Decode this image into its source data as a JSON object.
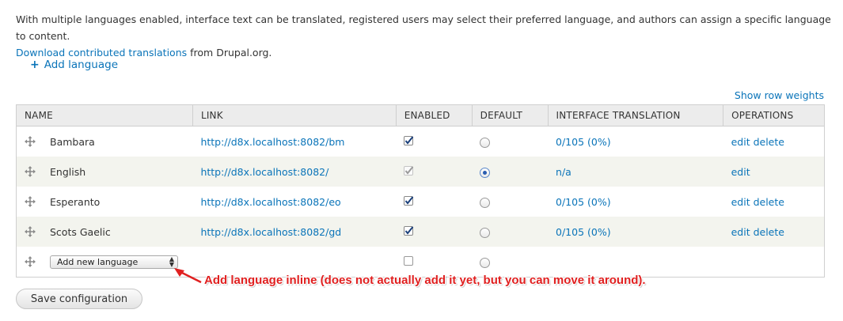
{
  "intro": {
    "text": "With multiple languages enabled, interface text can be translated, registered users may select their preferred language, and authors can assign a specific language to content.",
    "link_text": "Download contributed translations",
    "link_suffix": " from Drupal.org."
  },
  "actions": {
    "add_language": "Add language",
    "show_row_weights": "Show row weights"
  },
  "table": {
    "headers": [
      "NAME",
      "LINK",
      "ENABLED",
      "DEFAULT",
      "INTERFACE TRANSLATION",
      "OPERATIONS"
    ],
    "rows": [
      {
        "name": "Bambara",
        "link": "http://d8x.localhost:8082/bm",
        "enabled": true,
        "default": false,
        "translation": "0/105 (0%)",
        "ops": [
          "edit",
          "delete"
        ]
      },
      {
        "name": "English",
        "link": "http://d8x.localhost:8082/",
        "enabled": true,
        "default": true,
        "translation": "n/a",
        "ops": [
          "edit"
        ]
      },
      {
        "name": "Esperanto",
        "link": "http://d8x.localhost:8082/eo",
        "enabled": true,
        "default": false,
        "translation": "0/105 (0%)",
        "ops": [
          "edit",
          "delete"
        ]
      },
      {
        "name": "Scots Gaelic",
        "link": "http://d8x.localhost:8082/gd",
        "enabled": true,
        "default": false,
        "translation": "0/105 (0%)",
        "ops": [
          "edit",
          "delete"
        ]
      }
    ],
    "new_row": {
      "select_value": "Add new language",
      "enabled": false,
      "default": false
    }
  },
  "annotation": "Add language inline (does not actually add it  yet, but you can move it around).",
  "save_button": "Save configuration",
  "colors": {
    "link": "#0a74b9",
    "annotation": "#e02020",
    "header_bg": "#ececec",
    "even_row_bg": "#f3f4ee"
  }
}
